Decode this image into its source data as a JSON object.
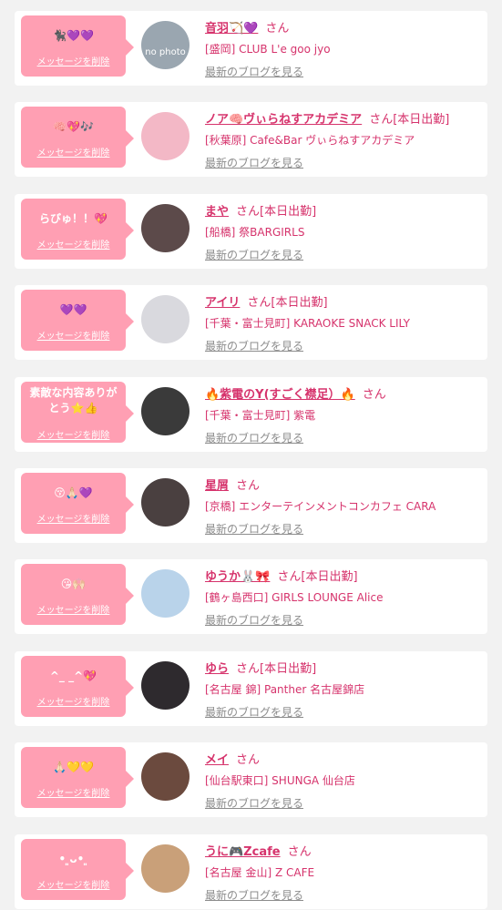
{
  "colors": {
    "bubble": "#ff9fb3",
    "accent": "#d6336c",
    "muted": "#8c8c8c",
    "background": "#f2f2f2"
  },
  "common": {
    "delete_label": "メッセージを削除",
    "blog_link_label": "最新のブログを見る",
    "honorific": "さん"
  },
  "messages": [
    {
      "bubble_text": "🐈‍⬛💜💜",
      "name": "音羽🏹💜",
      "today_tag": "",
      "shop": "[盛岡] CLUB L'e goo jyo",
      "avatar_icon": "no-photo-icon",
      "avatar_text": "no photo",
      "avatar_color": "#9aa6b0"
    },
    {
      "bubble_text": "🧠💖🎶",
      "name": "ノア🧠ヴぃらねすアカデミア",
      "today_tag": "[本日出勤]",
      "shop": "[秋葉原] Cafe&Bar ヴぃらねすアカデミア",
      "avatar_icon": "cast-photo-icon",
      "avatar_color": "#f3b8c6"
    },
    {
      "bubble_text": "らびゅ！！💖",
      "name": "まや",
      "today_tag": "[本日出勤]",
      "shop": "[船橋] 祭BARGIRLS",
      "avatar_icon": "cast-photo-icon",
      "avatar_color": "#5c4a4a"
    },
    {
      "bubble_text": "💜💜",
      "name": "アイリ",
      "today_tag": "[本日出勤]",
      "shop": "[千葉・富士見町] KARAOKE SNACK LILY",
      "avatar_icon": "cast-photo-icon",
      "avatar_color": "#d9d9de"
    },
    {
      "bubble_text": "素敵な内容ありがとう⭐️👍",
      "name": "🔥紫電のY(すごく襟足）🔥",
      "today_tag": "",
      "shop": "[千葉・富士見町] 紫電",
      "avatar_icon": "cast-photo-icon",
      "avatar_color": "#3a3a3a"
    },
    {
      "bubble_text": "😚🙏🏻💜",
      "name": "星屑",
      "today_tag": "",
      "shop": "[京橋] エンターテインメントコンカフェ CARA",
      "avatar_icon": "cast-photo-icon",
      "avatar_color": "#4a4040"
    },
    {
      "bubble_text": "😘🙌🏻",
      "name": "ゆうか🐰🎀",
      "today_tag": "[本日出勤]",
      "shop": "[鶴ヶ島西口] GIRLS LOUNGE Alice",
      "avatar_icon": "cast-photo-icon",
      "avatar_color": "#b9d3ea"
    },
    {
      "bubble_text": "^_ _^💖",
      "name": "ゆら",
      "today_tag": "[本日出勤]",
      "shop": "[名古屋 錦] Panther 名古屋錦店",
      "avatar_icon": "cast-photo-icon",
      "avatar_color": "#2e2a2e"
    },
    {
      "bubble_text": "🙏🏻💛💛",
      "name": "メイ",
      "today_tag": "",
      "shop": "[仙台駅東口] SHUNGA 仙台店",
      "avatar_icon": "cast-photo-icon",
      "avatar_color": "#6b4a3e"
    },
    {
      "bubble_text": "• ͈ᴗ• ͈",
      "name": "うに🎮Zcafe",
      "today_tag": "",
      "shop": "[名古屋 金山] Z CAFE",
      "avatar_icon": "cast-photo-icon",
      "avatar_color": "#c9a079"
    }
  ]
}
